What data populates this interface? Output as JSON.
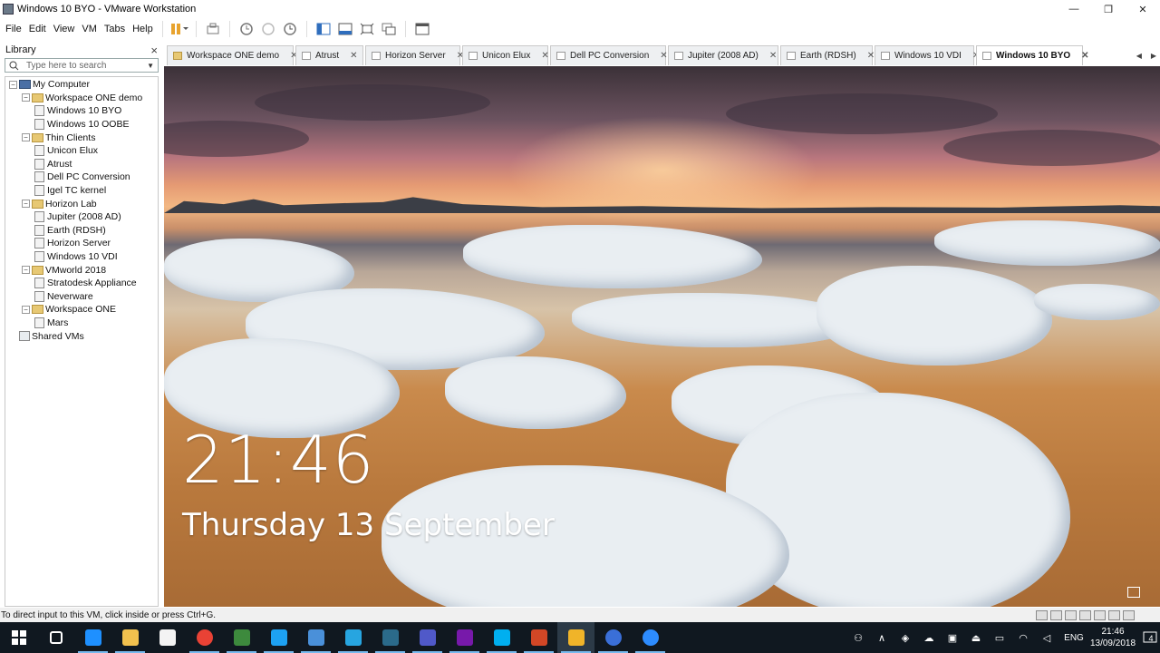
{
  "window": {
    "title": "Windows 10 BYO - VMware Workstation",
    "minimize": "—",
    "maximize": "❐",
    "close": "✕"
  },
  "menus": [
    "File",
    "Edit",
    "View",
    "VM",
    "Tabs",
    "Help"
  ],
  "library": {
    "title": "Library",
    "close": "×",
    "search_placeholder": "Type here to search",
    "tree": [
      {
        "label": "My Computer",
        "depth": 0,
        "kind": "pc",
        "expander": "⊟"
      },
      {
        "label": "Workspace ONE demo",
        "depth": 1,
        "kind": "folder",
        "expander": "⊟"
      },
      {
        "label": "Windows 10 BYO",
        "depth": 2,
        "kind": "vm"
      },
      {
        "label": "Windows 10 OOBE",
        "depth": 2,
        "kind": "vm"
      },
      {
        "label": "Thin Clients",
        "depth": 1,
        "kind": "folder",
        "expander": "⊟"
      },
      {
        "label": "Unicon Elux",
        "depth": 2,
        "kind": "vm"
      },
      {
        "label": "Atrust",
        "depth": 2,
        "kind": "vm"
      },
      {
        "label": "Dell PC Conversion",
        "depth": 2,
        "kind": "vm"
      },
      {
        "label": "Igel TC kernel",
        "depth": 2,
        "kind": "vm"
      },
      {
        "label": "Horizon Lab",
        "depth": 1,
        "kind": "folder",
        "expander": "⊟"
      },
      {
        "label": "Jupiter (2008 AD)",
        "depth": 2,
        "kind": "vm"
      },
      {
        "label": "Earth (RDSH)",
        "depth": 2,
        "kind": "vm"
      },
      {
        "label": "Horizon Server",
        "depth": 2,
        "kind": "vm"
      },
      {
        "label": "Windows 10 VDI",
        "depth": 2,
        "kind": "vm"
      },
      {
        "label": "VMworld 2018",
        "depth": 1,
        "kind": "folder",
        "expander": "⊟"
      },
      {
        "label": "Stratodesk Appliance",
        "depth": 2,
        "kind": "vm"
      },
      {
        "label": "Neverware",
        "depth": 2,
        "kind": "vm"
      },
      {
        "label": "Workspace ONE",
        "depth": 1,
        "kind": "folder",
        "expander": "⊟"
      },
      {
        "label": "Mars",
        "depth": 2,
        "kind": "vm"
      },
      {
        "label": "Shared VMs",
        "depth": 0,
        "kind": "share"
      }
    ]
  },
  "tabs": [
    {
      "label": "Workspace ONE demo",
      "kind": "folder",
      "active": false
    },
    {
      "label": "Atrust",
      "kind": "vm",
      "active": false
    },
    {
      "label": "Horizon Server",
      "kind": "vm",
      "active": false
    },
    {
      "label": "Unicon Elux",
      "kind": "vm",
      "active": false
    },
    {
      "label": "Dell PC Conversion",
      "kind": "vm",
      "active": false
    },
    {
      "label": "Jupiter (2008 AD)",
      "kind": "vm",
      "active": false
    },
    {
      "label": "Earth (RDSH)",
      "kind": "vm",
      "active": false
    },
    {
      "label": "Windows 10 VDI",
      "kind": "vm",
      "active": false
    },
    {
      "label": "Windows 10 BYO",
      "kind": "vm",
      "active": true
    }
  ],
  "tab_close": "✕",
  "tab_scroll": {
    "left": "◀",
    "right": "▶"
  },
  "lockscreen": {
    "time": "21:46",
    "date": "Thursday 13 September"
  },
  "statusbar": {
    "message": "To direct input to this VM, click inside or press Ctrl+G."
  },
  "taskbar": {
    "apps": [
      {
        "icon": "windows-start-icon",
        "color": "#ffffff"
      },
      {
        "icon": "task-view-icon",
        "color": "#ffffff"
      },
      {
        "icon": "edge-icon",
        "color": "#1e90ff"
      },
      {
        "icon": "file-explorer-icon",
        "color": "#f2c14e"
      },
      {
        "icon": "store-icon",
        "color": "#f3f3f3"
      },
      {
        "icon": "chrome-icon",
        "color": "#e94235"
      },
      {
        "icon": "snagit-icon",
        "color": "#3d8a3d"
      },
      {
        "icon": "twitter-icon",
        "color": "#1da1f2"
      },
      {
        "icon": "document-icon",
        "color": "#4a90d9"
      },
      {
        "icon": "internet-explorer-icon",
        "color": "#27a5e0"
      },
      {
        "icon": "terminal-icon",
        "color": "#2b6a8a"
      },
      {
        "icon": "teams-icon",
        "color": "#5059c9"
      },
      {
        "icon": "onenote-icon",
        "color": "#7719aa"
      },
      {
        "icon": "skype-icon",
        "color": "#00aff0"
      },
      {
        "icon": "powerpoint-icon",
        "color": "#d24726"
      },
      {
        "icon": "vmware-workstation-icon",
        "color": "#f0b429"
      },
      {
        "icon": "recording-icon",
        "color": "#3a6fd8"
      },
      {
        "icon": "zoom-icon",
        "color": "#2d8cff"
      }
    ],
    "tray": {
      "language": "ENG",
      "time": "21:46",
      "date": "13/09/2018",
      "notification_count": "4"
    }
  }
}
